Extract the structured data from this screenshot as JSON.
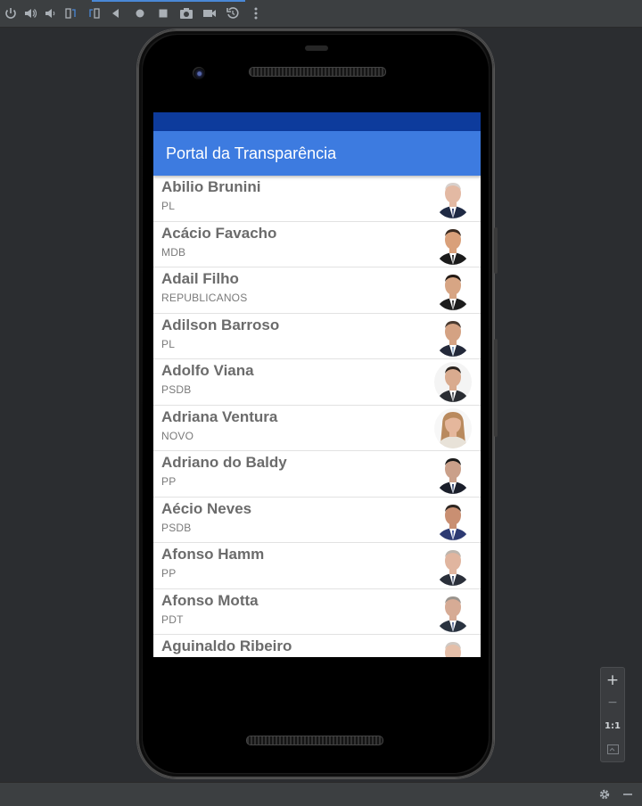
{
  "toolbar": {
    "icons": [
      "power-icon",
      "volume-up-icon",
      "volume-down-icon",
      "rotate-left-icon",
      "rotate-right-icon",
      "back-icon",
      "home-icon",
      "overview-icon",
      "camera-icon",
      "video-icon",
      "snapshot-icon",
      "more-icon"
    ]
  },
  "app": {
    "title": "Portal da Transparência",
    "colors": {
      "status_bar": "#0d3b9c",
      "app_bar": "#3d7be0",
      "name_text": "#6b6b6b"
    }
  },
  "deputados": [
    {
      "name": "Abilio Brunini",
      "party": "PL",
      "skin": "#e3b9a3",
      "hair": "#d8d0cc",
      "suit": "#1f2a44",
      "tie": "#2a3a6a",
      "bg": "#ffffff"
    },
    {
      "name": "Acácio Favacho",
      "party": "MDB",
      "skin": "#d9a07a",
      "hair": "#3a2a20",
      "suit": "#1b1b1b",
      "tie": "#222222",
      "bg": "#ffffff"
    },
    {
      "name": "Adail Filho",
      "party": "REPUBLICANOS",
      "skin": "#d7a584",
      "hair": "#241a14",
      "suit": "#1c1c1c",
      "tie": "#2b2b2b",
      "bg": "#ffffff"
    },
    {
      "name": "Adilson Barroso",
      "party": "PL",
      "skin": "#d4a283",
      "hair": "#4a3a30",
      "suit": "#23293a",
      "tie": "#6f8fb5",
      "bg": "#ffffff"
    },
    {
      "name": "Adolfo Viana",
      "party": "PSDB",
      "skin": "#d9ab8f",
      "hair": "#2c241f",
      "suit": "#2a2d33",
      "tie": "#3b3f47",
      "bg": "#f4f4f4"
    },
    {
      "name": "Adriana Ventura",
      "party": "NOVO",
      "skin": "#e5b79c",
      "hair": "#b98a5e",
      "suit": "#e8e2d8",
      "tie": "#e8e2d8",
      "bg": "#f7f7f7"
    },
    {
      "name": "Adriano do Baldy",
      "party": "PP",
      "skin": "#caa08a",
      "hair": "#1a1a1a",
      "suit": "#1a1e2a",
      "tie": "#263a66",
      "bg": "#ffffff"
    },
    {
      "name": "Aécio Neves",
      "party": "PSDB",
      "skin": "#c98f72",
      "hair": "#2d2520",
      "suit": "#2d3a72",
      "tie": "#3a4f9a",
      "bg": "#ffffff"
    },
    {
      "name": "Afonso Hamm",
      "party": "PP",
      "skin": "#e0b59f",
      "hair": "#bdb5ad",
      "suit": "#2a2f3a",
      "tie": "#3a4a6a",
      "bg": "#ffffff"
    },
    {
      "name": "Afonso Motta",
      "party": "PDT",
      "skin": "#d6ab95",
      "hair": "#9a948e",
      "suit": "#2a3340",
      "tie": "#4a5d8a",
      "bg": "#ffffff"
    },
    {
      "name": "Aguinaldo Ribeiro",
      "party": "",
      "skin": "#e5bfa9",
      "hair": "#cfc8c2",
      "suit": "#263048",
      "tie": "#2f3b5a",
      "bg": "#ffffff"
    }
  ],
  "zoom": {
    "plus": "+",
    "minus": "−",
    "ratio": "1:1"
  }
}
